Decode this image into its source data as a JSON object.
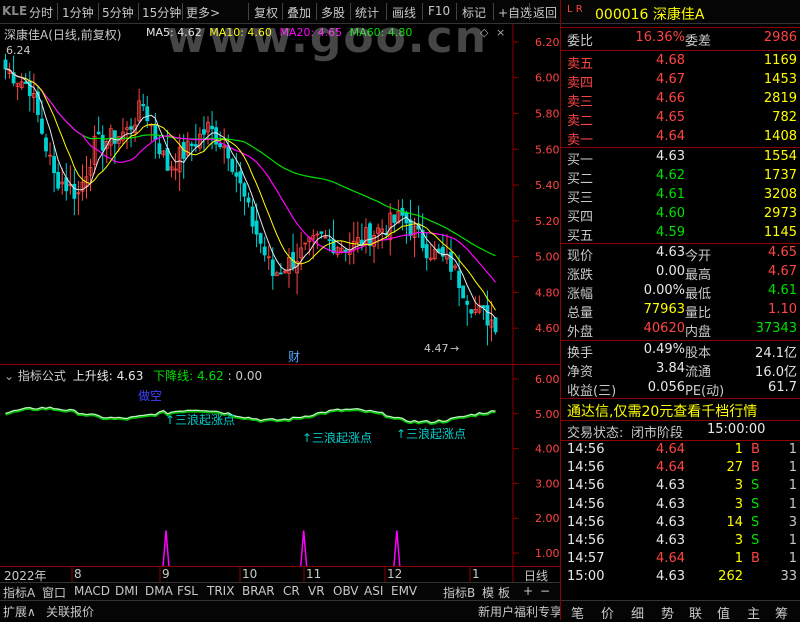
{
  "toolbar": {
    "logo": "KLE",
    "items": [
      "分时",
      "1分钟",
      "5分钟",
      "15分钟",
      "更多>",
      "复权",
      "叠加",
      "多股",
      "统计",
      "画线",
      "F10",
      "标记",
      "+自选",
      "返回"
    ]
  },
  "watermark": "www.goo.cn",
  "chart": {
    "title": "深康佳A(日线,前复权)",
    "ma": [
      {
        "label": "MA5: 4.62",
        "color": "#e8e8e8"
      },
      {
        "label": "MA10: 4.60",
        "color": "#ffff00"
      },
      {
        "label": "MA20: 4.65",
        "color": "#ff00ff"
      },
      {
        "label": "MA60: 4.80",
        "color": "#00e000"
      }
    ],
    "high_label": "6.24",
    "low_label": "4.47",
    "cai_label": "财",
    "y_ticks": [
      "6.20",
      "6.00",
      "5.80",
      "5.60",
      "5.40",
      "5.20",
      "5.00",
      "4.80",
      "4.60"
    ]
  },
  "indicator": {
    "name": "指标公式",
    "up_label": "上升线:",
    "up_value": "4.63",
    "down_label": "下降线:",
    "down_value": "4.62",
    "extra": ": 0.00",
    "annotations": [
      "做空",
      "↑三浪起涨点",
      "↑三浪起涨点",
      "↑三浪起涨点"
    ],
    "y_ticks": [
      "6.00",
      "5.00",
      "4.00",
      "3.00",
      "2.00",
      "1.00"
    ]
  },
  "xaxis": {
    "labels": [
      "2022年",
      "8",
      "9",
      "10",
      "11",
      "12",
      "1"
    ],
    "period": "日线"
  },
  "tabs": [
    "指标A",
    "窗口",
    "MACD",
    "DMI",
    "DMA",
    "FSL",
    "TRIX",
    "BRAR",
    "CR",
    "VR",
    "OBV",
    "ASI",
    "EMV",
    "指标B",
    "模",
    "板"
  ],
  "tabs2": [
    "扩展∧",
    "关联报价"
  ],
  "tabs2_right": "新用户福利专享",
  "quote": {
    "header_lr": "L R",
    "header_code": "000016 深康佳A",
    "weibi_label": "委比",
    "weibi": "16.36%",
    "weicha_label": "委差",
    "weicha": "2986",
    "asks": [
      {
        "label": "卖五",
        "price": "4.68",
        "vol": "1169"
      },
      {
        "label": "卖四",
        "price": "4.67",
        "vol": "1453"
      },
      {
        "label": "卖三",
        "price": "4.66",
        "vol": "2819"
      },
      {
        "label": "卖二",
        "price": "4.65",
        "vol": "782"
      },
      {
        "label": "卖一",
        "price": "4.64",
        "vol": "1408"
      }
    ],
    "bids": [
      {
        "label": "买一",
        "price": "4.63",
        "vol": "1554",
        "color": "white"
      },
      {
        "label": "买二",
        "price": "4.62",
        "vol": "1737",
        "color": "green"
      },
      {
        "label": "买三",
        "price": "4.61",
        "vol": "3208",
        "color": "green"
      },
      {
        "label": "买四",
        "price": "4.60",
        "vol": "2973",
        "color": "green"
      },
      {
        "label": "买五",
        "price": "4.59",
        "vol": "1145",
        "color": "green"
      }
    ],
    "stats": [
      {
        "l1": "现价",
        "v1": "4.63",
        "c1": "white",
        "l2": "今开",
        "v2": "4.65",
        "c2": "red"
      },
      {
        "l1": "涨跌",
        "v1": "0.00",
        "c1": "white",
        "l2": "最高",
        "v2": "4.67",
        "c2": "red"
      },
      {
        "l1": "涨幅",
        "v1": "0.00%",
        "c1": "white",
        "l2": "最低",
        "v2": "4.61",
        "c2": "green"
      },
      {
        "l1": "总量",
        "v1": "77963",
        "c1": "yellow",
        "l2": "量比",
        "v2": "1.10",
        "c2": "red"
      },
      {
        "l1": "外盘",
        "v1": "40620",
        "c1": "red",
        "l2": "内盘",
        "v2": "37343",
        "c2": "green"
      }
    ],
    "stats2": [
      {
        "l1": "换手",
        "v1": "0.49%",
        "l2": "股本",
        "v2": "24.1亿"
      },
      {
        "l1": "净资",
        "v1": "3.84",
        "l2": "流通",
        "v2": "16.0亿"
      },
      {
        "l1": "收益(三)",
        "v1": "0.056",
        "l2": "PE(动)",
        "v2": "61.7"
      }
    ],
    "promo": "通达信,仅需20元查看千档行情",
    "status_label": "交易状态:",
    "status_value": "闭市阶段",
    "status_time": "15:00:00",
    "ticks": [
      {
        "t": "14:56",
        "p": "4.64",
        "pc": "red",
        "v": "1",
        "d": "B",
        "dc": "red",
        "n": "1"
      },
      {
        "t": "14:56",
        "p": "4.64",
        "pc": "red",
        "v": "27",
        "d": "B",
        "dc": "red",
        "n": "1"
      },
      {
        "t": "14:56",
        "p": "4.63",
        "pc": "white",
        "v": "3",
        "d": "S",
        "dc": "green",
        "n": "1"
      },
      {
        "t": "14:56",
        "p": "4.63",
        "pc": "white",
        "v": "3",
        "d": "S",
        "dc": "green",
        "n": "1"
      },
      {
        "t": "14:56",
        "p": "4.63",
        "pc": "white",
        "v": "14",
        "d": "S",
        "dc": "green",
        "n": "3"
      },
      {
        "t": "14:56",
        "p": "4.63",
        "pc": "white",
        "v": "3",
        "d": "S",
        "dc": "green",
        "n": "1"
      },
      {
        "t": "14:57",
        "p": "4.64",
        "pc": "red",
        "v": "1",
        "d": "B",
        "dc": "red",
        "n": "1"
      },
      {
        "t": "15:00",
        "p": "4.63",
        "pc": "white",
        "v": "262",
        "d": "",
        "dc": "white",
        "n": "33"
      }
    ]
  },
  "rtabs": [
    "笔",
    "价",
    "细",
    "势",
    "联",
    "值",
    "主",
    "筹"
  ]
}
